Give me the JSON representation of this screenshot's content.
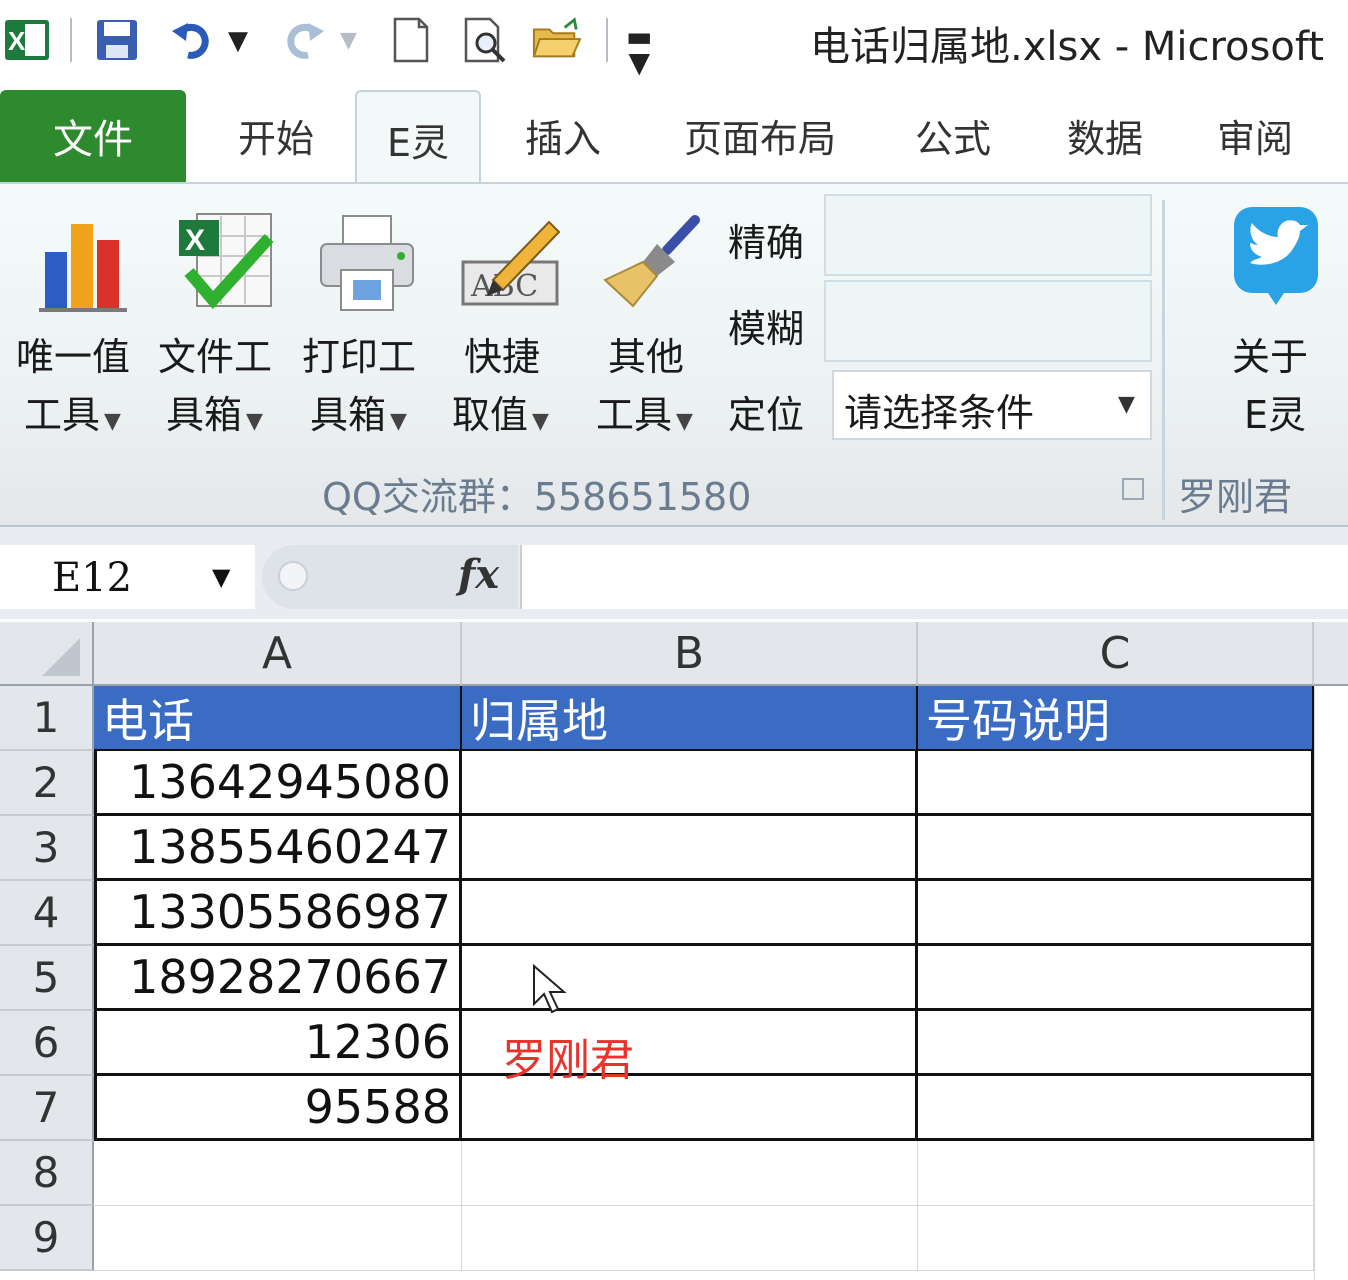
{
  "window": {
    "title": "电话归属地.xlsx  -  Microsoft"
  },
  "quick_access": {
    "icons": [
      "excel-app-icon",
      "save-icon",
      "undo-icon",
      "redo-icon",
      "new-icon",
      "print-preview-icon",
      "open-icon",
      "customize-icon"
    ]
  },
  "tabs": [
    {
      "label": "文件"
    },
    {
      "label": "开始"
    },
    {
      "label": "E灵"
    },
    {
      "label": "插入"
    },
    {
      "label": "页面布局"
    },
    {
      "label": "公式"
    },
    {
      "label": "数据"
    },
    {
      "label": "审阅"
    }
  ],
  "ribbon": {
    "buttons": [
      {
        "line1": "唯一值",
        "line2": "工具"
      },
      {
        "line1": "文件工",
        "line2": "具箱"
      },
      {
        "line1": "打印工",
        "line2": "具箱"
      },
      {
        "line1": "快捷",
        "line2": "取值"
      },
      {
        "line1": "其他",
        "line2": "工具"
      }
    ],
    "precise_label": "精确",
    "fuzzy_label": "模糊",
    "locate_label": "定位",
    "select_value": "请选择条件",
    "about_line1": "关于",
    "about_line2": "E灵",
    "group_label": "QQ交流群：558651580",
    "group2_label": "罗刚君"
  },
  "formula_bar": {
    "name_box": "E12",
    "fx": "fx",
    "formula": ""
  },
  "sheet": {
    "columns": [
      "A",
      "B",
      "C"
    ],
    "rows": [
      "1",
      "2",
      "3",
      "4",
      "5",
      "6",
      "7",
      "8",
      "9"
    ],
    "header": [
      "电话",
      "归属地",
      "号码说明"
    ],
    "phones": [
      "13642945080",
      "13855460247",
      "13305586987",
      "18928270667",
      "12306",
      "95588"
    ],
    "overlay_text": "罗刚君"
  },
  "colors": {
    "tab_file": "#2e8a2e",
    "header_fill": "#3a6cc4",
    "overlay_red": "#e8332b"
  }
}
